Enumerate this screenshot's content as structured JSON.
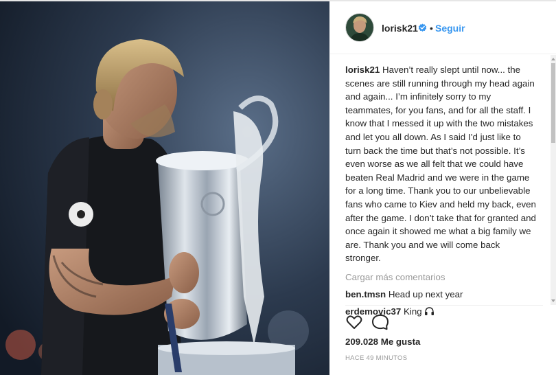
{
  "post": {
    "username": "lorisk21",
    "follow_label": "Seguir",
    "separator": "•",
    "icons": {
      "verified": "verified-badge-icon",
      "like": "heart-icon",
      "comment": "comment-bubble-icon",
      "emoji": "headphones-emoji-icon"
    },
    "accent_color": "#3897f0"
  },
  "caption": {
    "username": "lorisk21",
    "text": "Haven’t really slept until now... the scenes are still running through my head again and again... I’m infinitely sorry to my teammates, for you fans, and for all the staff. I know that I messed it up with the two mistakes and let you all down. As I said I’d just like to turn back the time but that’s not possible. It’s even worse as we all felt that we could have beaten Real Madrid and we were in the game for a long time. Thank you to our unbelievable fans who came to Kiev and held my back, even after the game. I don’t take that for granted and once again it showed me what a big family we are. Thank you and we will come back stronger."
  },
  "load_more": "Cargar más comentarios",
  "comments": [
    {
      "username": "ben.tmsn",
      "text": "Head up next year"
    },
    {
      "username": "erdemovic37",
      "text": "King"
    }
  ],
  "likes": "209.028 Me gusta",
  "timestamp": "HACE 49 MINUTOS"
}
